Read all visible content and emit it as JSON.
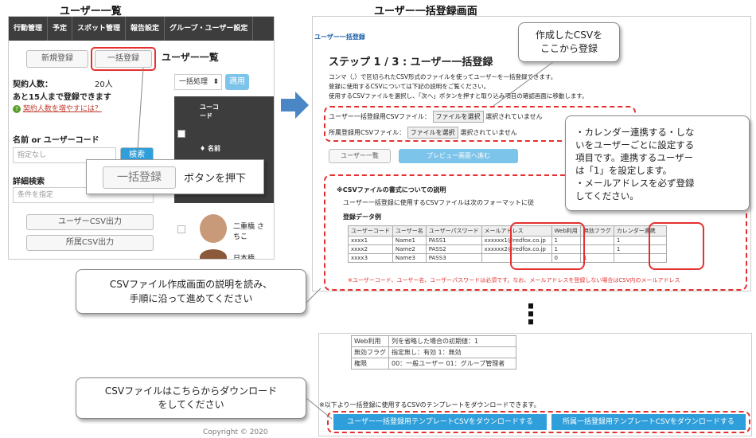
{
  "left_title": "ユーザー一覧",
  "right_title": "ユーザー一括登録画面",
  "nav_tabs": [
    "行動管理",
    "予定",
    "スポット管理",
    "報告設定",
    "グループ・ユーザー設定"
  ],
  "left": {
    "new_btn": "新規登録",
    "bulk_btn": "一括登録",
    "list_title": "ユーザー一覧",
    "contract_label": "契約人数：",
    "contract_value": "20人",
    "remain_text": "あと15人まで登録できます",
    "increase_link": "契約人数を増やすには？",
    "bulk_select": "一括処理",
    "apply_btn": "適用",
    "col_user_code": "ユーコード",
    "col_name": "名前",
    "name_code_label": "名前 or ユーザーコード",
    "name_placeholder": "指定なし",
    "search_btn": "検索",
    "detail_label": "詳細検索",
    "cond_placeholder": "条件を指定",
    "user_csv_btn": "ユーザーCSV出力",
    "belong_csv_btn": "所属CSV出力",
    "person1": "二重橋 さちこ",
    "person2": "日本橋"
  },
  "zoom": {
    "btn": "一括登録",
    "caption": "ボタンを押下"
  },
  "right": {
    "breadcrumb": "ユーザー一括登録",
    "step_title": "ステップ 1 / 3 : ユーザー一括登録",
    "desc1": "コンマ（,）で区切られたCSV形式のファイルを使ってユーザーを一括登録できます。",
    "desc2": "登録に使用するCSVについては下記の説明をご覧ください。",
    "desc3": "使用するCSVファイルを選択し、「次へ」ボタンを押すと取り込み項目の確認画面に移動します。",
    "file1_label": "ユーザー一括登録用CSVファイル：",
    "file2_label": "所属登録用CSVファイル：",
    "file_btn": "ファイルを選択",
    "file_none": "選択されていません",
    "back_btn": "ユーザー一覧",
    "preview_btn": "プレビュー画面へ進む",
    "csv_head": "※CSVファイルの書式についての説明",
    "csv_desc": "ユーザー一括登録に使用するCSVファイルは次のフォーマットに従",
    "example_label": "登録データ例",
    "table_headers": [
      "ユーザーコード",
      "ユーザー名",
      "ユーザーパスワード",
      "メールアドレス",
      "Web利用",
      "無効フラグ",
      "カレンダー連携"
    ],
    "table_rows": [
      [
        "xxxx1",
        "Name1",
        "PASS1",
        "xxxxxx1@redfox.co.jp",
        "1",
        "",
        "1"
      ],
      [
        "xxxx2",
        "Name2",
        "PASS2",
        "xxxxxx2@redfox.co.jp",
        "1",
        "",
        "1"
      ],
      [
        "xxxx3",
        "Name3",
        "PASS3",
        "",
        "0",
        "1",
        ""
      ]
    ],
    "note": "※ユーザーコード、ユーザー名、ユーザーパスワードは必須です。なお、メールアドレスを登録しない場合はCSV内のメールアドレス"
  },
  "right2": {
    "rows": [
      [
        "Web利用",
        "列を省略した場合の初期値：1"
      ],
      [
        "無効フラグ",
        "指定無し：有効 1：無効"
      ],
      [
        "権限",
        "00：一般ユーザー 01：グループ管理者"
      ]
    ],
    "template_note": "※以下より一括登録に使用するCSVのテンプレートをダウンロードできます。",
    "dl_user_btn": "ユーザー一括登録用テンプレートCSVをダウンロードする",
    "dl_belong_btn": "所属一括登録用テンプレートCSVをダウンロードする"
  },
  "callouts": {
    "csv_here_line1": "作成したCSVを",
    "csv_here_line2": "ここから登録",
    "calendar_line1": "・カレンダー連携する・しな",
    "calendar_line2": "いをユーザーごとに設定する",
    "calendar_line3": "項目です。連携するユーザー",
    "calendar_line4": "は「1」を設定します。",
    "calendar_line5": "・メールアドレスを必ず登録",
    "calendar_line6": "してください。",
    "read_line1": "CSVファイル作成画面の説明を読み、",
    "read_line2": "手順に沿って進めてください",
    "download_line1": "CSVファイルはこちらからダウンロード",
    "download_line2": "をしてください"
  },
  "ellipsis": "⋮",
  "copyright": "Copyright © 2020"
}
